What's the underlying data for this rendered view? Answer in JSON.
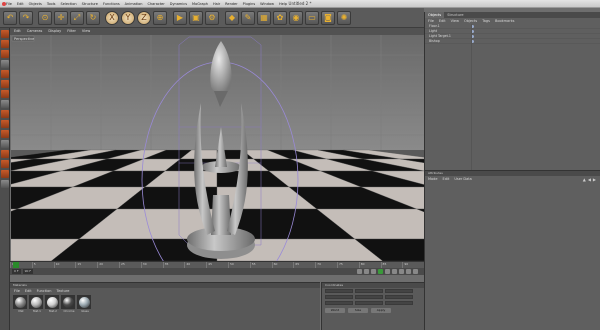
{
  "window": {
    "title": "Untitled 2 *",
    "menus": [
      "File",
      "Edit",
      "Objects",
      "Tools",
      "Selection",
      "Structure",
      "Functions",
      "Animation",
      "Character",
      "Dynamics",
      "MoGraph",
      "Hair",
      "Render",
      "Plugins",
      "Window",
      "Help"
    ]
  },
  "toolbar": {
    "buttons": [
      {
        "icon": "undo-icon",
        "glyph": "↶"
      },
      {
        "icon": "redo-icon",
        "glyph": "↷"
      },
      {
        "icon": "live-selection-icon",
        "glyph": "⊙"
      },
      {
        "icon": "move-icon",
        "glyph": "✛"
      },
      {
        "icon": "scale-icon",
        "glyph": "⤢"
      },
      {
        "icon": "rotate-icon",
        "glyph": "↻"
      },
      {
        "icon": "x-axis-icon",
        "glyph": "X"
      },
      {
        "icon": "y-axis-icon",
        "glyph": "Y"
      },
      {
        "icon": "z-axis-icon",
        "glyph": "Z"
      },
      {
        "icon": "coordinate-system-icon",
        "glyph": "⊕"
      },
      {
        "icon": "render-view-icon",
        "glyph": "▶"
      },
      {
        "icon": "render-picture-viewer-icon",
        "glyph": "▣"
      },
      {
        "icon": "render-settings-icon",
        "glyph": "⚙"
      },
      {
        "icon": "cube-icon",
        "glyph": "◆"
      },
      {
        "icon": "pen-icon",
        "glyph": "✎"
      },
      {
        "icon": "subdivision-icon",
        "glyph": "▦"
      },
      {
        "icon": "array-icon",
        "glyph": "✿"
      },
      {
        "icon": "deformer-icon",
        "glyph": "◉"
      },
      {
        "icon": "floor-icon",
        "glyph": "▭"
      },
      {
        "icon": "camera-icon",
        "glyph": "◙"
      },
      {
        "icon": "light-icon",
        "glyph": "✺"
      }
    ]
  },
  "viewport": {
    "menu": [
      "Edit",
      "Cameras",
      "Display",
      "Filter",
      "View"
    ],
    "label": "Perspective"
  },
  "timeline": {
    "ticks": [
      "0",
      "5",
      "10",
      "15",
      "20",
      "25",
      "30",
      "35",
      "40",
      "45",
      "50",
      "55",
      "60",
      "65",
      "70",
      "75",
      "80",
      "85",
      "90"
    ],
    "start_frame": "0 F",
    "end_frame": "90 F"
  },
  "materials": {
    "header": "Materials",
    "menu": [
      "File",
      "Edit",
      "Function",
      "Texture"
    ],
    "items": [
      {
        "name": "Mat",
        "color": "#8a8a8a"
      },
      {
        "name": "Mat.1",
        "color": "#b8b8b8"
      },
      {
        "name": "Mat.2",
        "color": "#d0d0d0"
      },
      {
        "name": "Chrome",
        "color": "#4a4a4a"
      },
      {
        "name": "Glass",
        "color": "#9aa8b0"
      }
    ]
  },
  "coordinates": {
    "header": "Coordinates",
    "buttons": [
      "World",
      "Size",
      "Apply"
    ]
  },
  "objects": {
    "tabs": [
      "Objects",
      "Structure"
    ],
    "menu": [
      "File",
      "Edit",
      "View",
      "Objects",
      "Tags",
      "Bookmarks"
    ],
    "items": [
      {
        "name": "Floor.1",
        "color": "#d8d8d8"
      },
      {
        "name": "Light",
        "color": "#d8d8d8"
      },
      {
        "name": "Light Target.1",
        "color": "#d8d8d8"
      },
      {
        "name": "Bishop",
        "color": "#d8d8d8"
      }
    ]
  },
  "attributes": {
    "header": "Attributes",
    "menu": [
      "Mode",
      "Edit",
      "User Data"
    ]
  }
}
